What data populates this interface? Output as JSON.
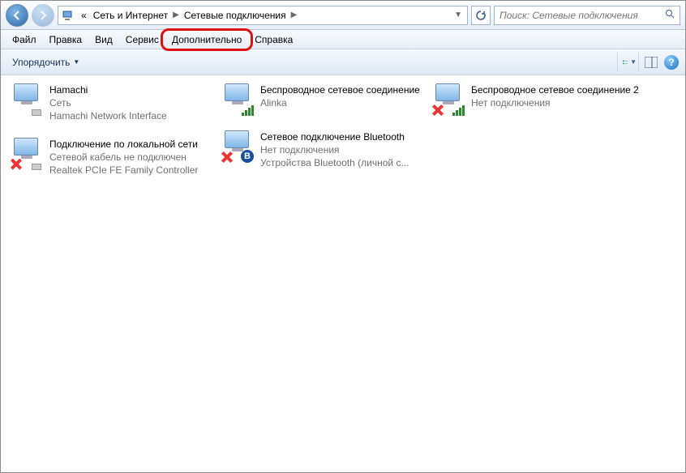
{
  "breadcrumb": {
    "root_prefix": "«",
    "seg1": "Сеть и Интернет",
    "seg2": "Сетевые подключения"
  },
  "search": {
    "placeholder": "Поиск: Сетевые подключения"
  },
  "menu": {
    "file": "Файл",
    "edit": "Правка",
    "view": "Вид",
    "service": "Сервис",
    "advanced": "Дополнительно",
    "help": "Справка"
  },
  "toolbar": {
    "organize": "Упорядочить"
  },
  "connections": [
    {
      "title": "Hamachi",
      "sub1": "Сеть",
      "sub2": "Hamachi Network Interface",
      "icon": "net",
      "overlay": "cable"
    },
    {
      "title": "Подключение по локальной сети",
      "sub1": "Сетевой кабель не подключен",
      "sub2": "Realtek PCIe FE Family Controller",
      "icon": "net",
      "overlay": "cross-cable"
    },
    {
      "title": "Беспроводное сетевое соединение",
      "sub1": "Alinka",
      "sub2": "",
      "icon": "net",
      "overlay": "bars"
    },
    {
      "title": "Сетевое подключение Bluetooth",
      "sub1": "Нет подключения",
      "sub2": "Устройства Bluetooth (личной с...",
      "icon": "net",
      "overlay": "cross-bt"
    },
    {
      "title": "Беспроводное сетевое соединение 2",
      "sub1": "Нет подключения",
      "sub2": "",
      "icon": "net",
      "overlay": "cross-bars"
    }
  ]
}
